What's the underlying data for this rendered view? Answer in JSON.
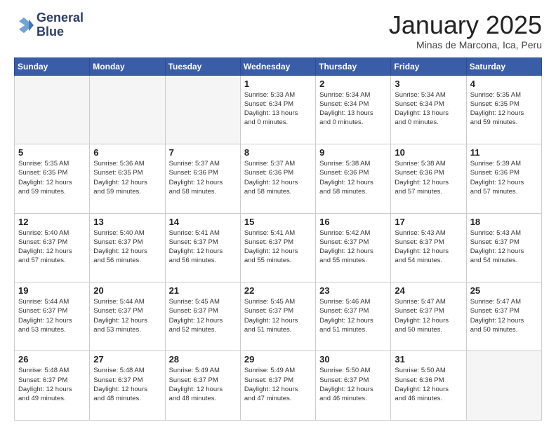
{
  "logo": {
    "line1": "General",
    "line2": "Blue"
  },
  "title": "January 2025",
  "subtitle": "Minas de Marcona, Ica, Peru",
  "days_header": [
    "Sunday",
    "Monday",
    "Tuesday",
    "Wednesday",
    "Thursday",
    "Friday",
    "Saturday"
  ],
  "weeks": [
    [
      {
        "day": "",
        "info": ""
      },
      {
        "day": "",
        "info": ""
      },
      {
        "day": "",
        "info": ""
      },
      {
        "day": "1",
        "info": "Sunrise: 5:33 AM\nSunset: 6:34 PM\nDaylight: 13 hours\nand 0 minutes."
      },
      {
        "day": "2",
        "info": "Sunrise: 5:34 AM\nSunset: 6:34 PM\nDaylight: 13 hours\nand 0 minutes."
      },
      {
        "day": "3",
        "info": "Sunrise: 5:34 AM\nSunset: 6:34 PM\nDaylight: 13 hours\nand 0 minutes."
      },
      {
        "day": "4",
        "info": "Sunrise: 5:35 AM\nSunset: 6:35 PM\nDaylight: 12 hours\nand 59 minutes."
      }
    ],
    [
      {
        "day": "5",
        "info": "Sunrise: 5:35 AM\nSunset: 6:35 PM\nDaylight: 12 hours\nand 59 minutes."
      },
      {
        "day": "6",
        "info": "Sunrise: 5:36 AM\nSunset: 6:35 PM\nDaylight: 12 hours\nand 59 minutes."
      },
      {
        "day": "7",
        "info": "Sunrise: 5:37 AM\nSunset: 6:36 PM\nDaylight: 12 hours\nand 58 minutes."
      },
      {
        "day": "8",
        "info": "Sunrise: 5:37 AM\nSunset: 6:36 PM\nDaylight: 12 hours\nand 58 minutes."
      },
      {
        "day": "9",
        "info": "Sunrise: 5:38 AM\nSunset: 6:36 PM\nDaylight: 12 hours\nand 58 minutes."
      },
      {
        "day": "10",
        "info": "Sunrise: 5:38 AM\nSunset: 6:36 PM\nDaylight: 12 hours\nand 57 minutes."
      },
      {
        "day": "11",
        "info": "Sunrise: 5:39 AM\nSunset: 6:36 PM\nDaylight: 12 hours\nand 57 minutes."
      }
    ],
    [
      {
        "day": "12",
        "info": "Sunrise: 5:40 AM\nSunset: 6:37 PM\nDaylight: 12 hours\nand 57 minutes."
      },
      {
        "day": "13",
        "info": "Sunrise: 5:40 AM\nSunset: 6:37 PM\nDaylight: 12 hours\nand 56 minutes."
      },
      {
        "day": "14",
        "info": "Sunrise: 5:41 AM\nSunset: 6:37 PM\nDaylight: 12 hours\nand 56 minutes."
      },
      {
        "day": "15",
        "info": "Sunrise: 5:41 AM\nSunset: 6:37 PM\nDaylight: 12 hours\nand 55 minutes."
      },
      {
        "day": "16",
        "info": "Sunrise: 5:42 AM\nSunset: 6:37 PM\nDaylight: 12 hours\nand 55 minutes."
      },
      {
        "day": "17",
        "info": "Sunrise: 5:43 AM\nSunset: 6:37 PM\nDaylight: 12 hours\nand 54 minutes."
      },
      {
        "day": "18",
        "info": "Sunrise: 5:43 AM\nSunset: 6:37 PM\nDaylight: 12 hours\nand 54 minutes."
      }
    ],
    [
      {
        "day": "19",
        "info": "Sunrise: 5:44 AM\nSunset: 6:37 PM\nDaylight: 12 hours\nand 53 minutes."
      },
      {
        "day": "20",
        "info": "Sunrise: 5:44 AM\nSunset: 6:37 PM\nDaylight: 12 hours\nand 53 minutes."
      },
      {
        "day": "21",
        "info": "Sunrise: 5:45 AM\nSunset: 6:37 PM\nDaylight: 12 hours\nand 52 minutes."
      },
      {
        "day": "22",
        "info": "Sunrise: 5:45 AM\nSunset: 6:37 PM\nDaylight: 12 hours\nand 51 minutes."
      },
      {
        "day": "23",
        "info": "Sunrise: 5:46 AM\nSunset: 6:37 PM\nDaylight: 12 hours\nand 51 minutes."
      },
      {
        "day": "24",
        "info": "Sunrise: 5:47 AM\nSunset: 6:37 PM\nDaylight: 12 hours\nand 50 minutes."
      },
      {
        "day": "25",
        "info": "Sunrise: 5:47 AM\nSunset: 6:37 PM\nDaylight: 12 hours\nand 50 minutes."
      }
    ],
    [
      {
        "day": "26",
        "info": "Sunrise: 5:48 AM\nSunset: 6:37 PM\nDaylight: 12 hours\nand 49 minutes."
      },
      {
        "day": "27",
        "info": "Sunrise: 5:48 AM\nSunset: 6:37 PM\nDaylight: 12 hours\nand 48 minutes."
      },
      {
        "day": "28",
        "info": "Sunrise: 5:49 AM\nSunset: 6:37 PM\nDaylight: 12 hours\nand 48 minutes."
      },
      {
        "day": "29",
        "info": "Sunrise: 5:49 AM\nSunset: 6:37 PM\nDaylight: 12 hours\nand 47 minutes."
      },
      {
        "day": "30",
        "info": "Sunrise: 5:50 AM\nSunset: 6:37 PM\nDaylight: 12 hours\nand 46 minutes."
      },
      {
        "day": "31",
        "info": "Sunrise: 5:50 AM\nSunset: 6:36 PM\nDaylight: 12 hours\nand 46 minutes."
      },
      {
        "day": "",
        "info": ""
      }
    ]
  ]
}
